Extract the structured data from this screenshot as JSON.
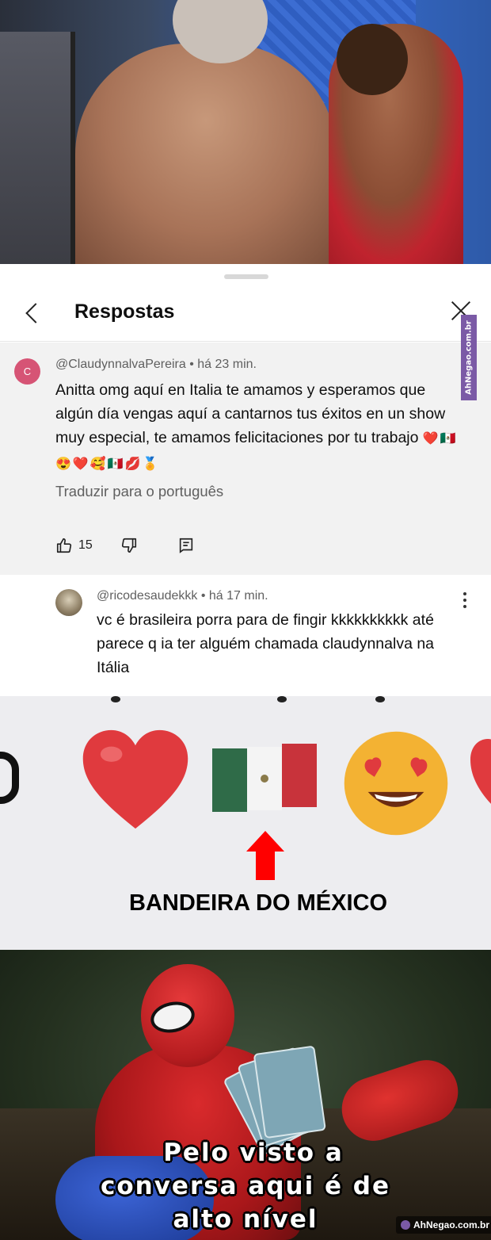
{
  "sheet": {
    "title": "Respostas",
    "watermark": "AhNegao.com.br"
  },
  "main_comment": {
    "avatar_letter": "C",
    "meta": "@ClaudynnalvaPereira • há 23 min.",
    "text": "Anitta omg aquí en Italia te amamos y esperamos que algún día vengas aquí a cantarnos tus éxitos en un show muy especial, te amamos felicitaciones por tu trabajo",
    "emojis": "❤️🇲🇽😍❤️🥰🇲🇽💋🏅",
    "translate": "Traduzir para o português",
    "like_count": "15",
    "icons": [
      "thumbs-up-icon",
      "thumbs-down-icon",
      "reply-icon"
    ]
  },
  "reply_comment": {
    "meta": "@ricodesaudekkk • há 17 min.",
    "text": "vc é brasileira porra para de fingir kkkkkkkkkk até parece q ia ter alguém chamada claudynnalva na Itália"
  },
  "zoom": {
    "caption": "BANDEIRA DO MÉXICO",
    "colors": {
      "heart": "#e03a3e",
      "flag_green": "#2f6b48",
      "flag_red": "#c8333b",
      "arrow": "#ff0000",
      "smiley": "#f3b233"
    }
  },
  "meme": {
    "line1": "Pelo visto a",
    "line2": "conversa aqui é de",
    "line3": "alto nível",
    "watermark": "AhNegao.com.br"
  }
}
